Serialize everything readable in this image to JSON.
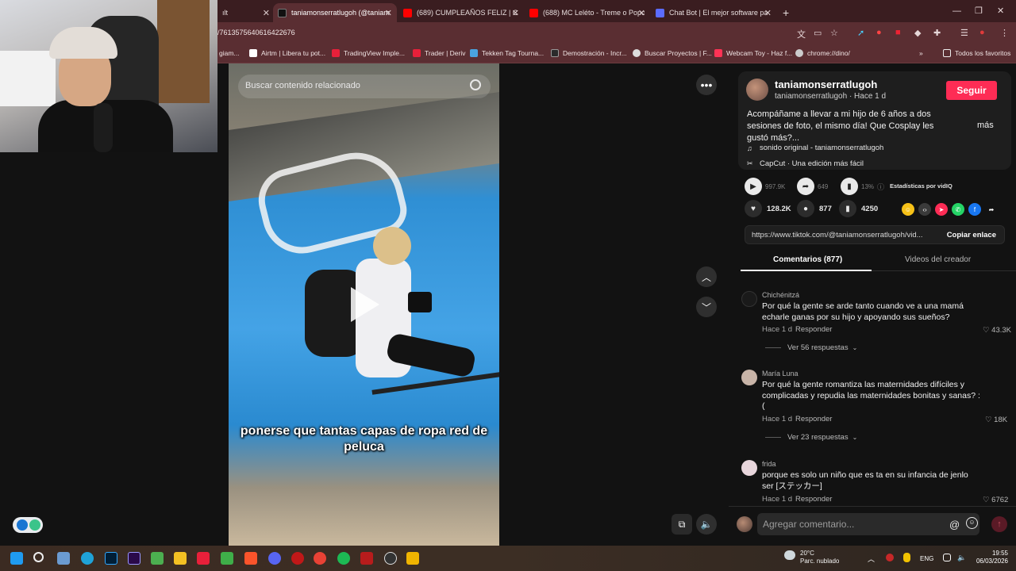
{
  "browser": {
    "tabs": [
      {
        "title": "ılt",
        "fav": "#8a6d6d",
        "x": 0
      },
      {
        "title": "taniamonserratlugoh (@taniam",
        "fav": "#111111",
        "x": 1
      },
      {
        "title": "(689) CUMPLEAÑOS FELIZ | Can",
        "fav": "#ff0000",
        "x": 2
      },
      {
        "title": "(688) MC Leléto - Treme o Popo",
        "fav": "#ff0000",
        "x": 3
      },
      {
        "title": "Chat Bot | El mejor software pa",
        "fav": "#5b6cff",
        "x": 4
      }
    ],
    "new_tab": "+",
    "url": "/7613575640616422676",
    "bookmarks": [
      {
        "label": "giam...",
        "color": "#888888"
      },
      {
        "label": "Airtm | Libera tu pot...",
        "color": "#ffffff"
      },
      {
        "label": "TradingView Imple...",
        "color": "#e8203a"
      },
      {
        "label": "Trader | Deriv",
        "color": "#e8203a"
      },
      {
        "label": "Tekken Tag Tourna...",
        "color": "#4aa3df"
      },
      {
        "label": "Demostración - Incr...",
        "color": "#2b2b2b"
      },
      {
        "label": "Buscar Proyectos | F...",
        "color": "#dddddd"
      },
      {
        "label": "Webcam Toy - Haz f...",
        "color": "#ff3355"
      },
      {
        "label": "chrome://dino/",
        "color": "#cccccc"
      }
    ],
    "all_bookmarks": "Todos los favoritos"
  },
  "video": {
    "search_placeholder": "Buscar contenido relacionado",
    "caption": "ponerse que tantas capas de ropa red de peluca"
  },
  "post": {
    "author": "taniamonserratlugoh",
    "author_sub": "taniamonserratlugoh · Hace 1 d",
    "follow": "Seguir",
    "description": "Acompáñame a llevar a mi hijo de 6 años a dos sesiones de foto, el mismo día! Que Cosplay les gustó más?...",
    "more": "más",
    "sound": "sonido original - taniamonserratlugoh",
    "capcut": "CapCut · Una edición más fácil"
  },
  "vidiq": {
    "plays": "997.9K",
    "shares": "649",
    "rate": "13%",
    "label": "Estadísticas por vidIQ"
  },
  "actions": {
    "likes": "128.2K",
    "comments": "877",
    "saves": "4250"
  },
  "link": {
    "url": "https://www.tiktok.com/@taniamonserratlugoh/vid...",
    "copy": "Copiar enlace"
  },
  "tabs": {
    "comments": "Comentarios (877)",
    "creator": "Videos del creador"
  },
  "comments": [
    {
      "name": "Chichénitzá",
      "text": "Por qué la gente se arde tanto cuando ve a una mamá echarle ganas por su hijo y apoyando sus sueños?",
      "time": "Hace 1 d",
      "reply": "Responder",
      "likes": "43.3K",
      "view": "Ver 56 respuestas",
      "avatar": "#1a1a1a"
    },
    {
      "name": "María Luna",
      "text": "Por qué la gente romantiza las maternidades difíciles y complicadas y repudia las maternidades bonitas y sanas? :(",
      "time": "Hace 1 d",
      "reply": "Responder",
      "likes": "18K",
      "view": "Ver 23 respuestas",
      "avatar": "#c8b4a8"
    },
    {
      "name": "frida",
      "text": "porque es solo un niño que es ta en su infancia de jenlo ser [ステッカー]",
      "time": "Hace 1 d",
      "reply": "Responder",
      "likes": "6762",
      "view": "",
      "avatar": "#e8d6dc"
    }
  ],
  "comment_input_placeholder": "Agregar comentario...",
  "taskbar": {
    "weather_temp": "20°C",
    "weather_desc": "Parc. nublado",
    "lang": "ENG",
    "time": "19:55",
    "date": "06/03/2026"
  }
}
